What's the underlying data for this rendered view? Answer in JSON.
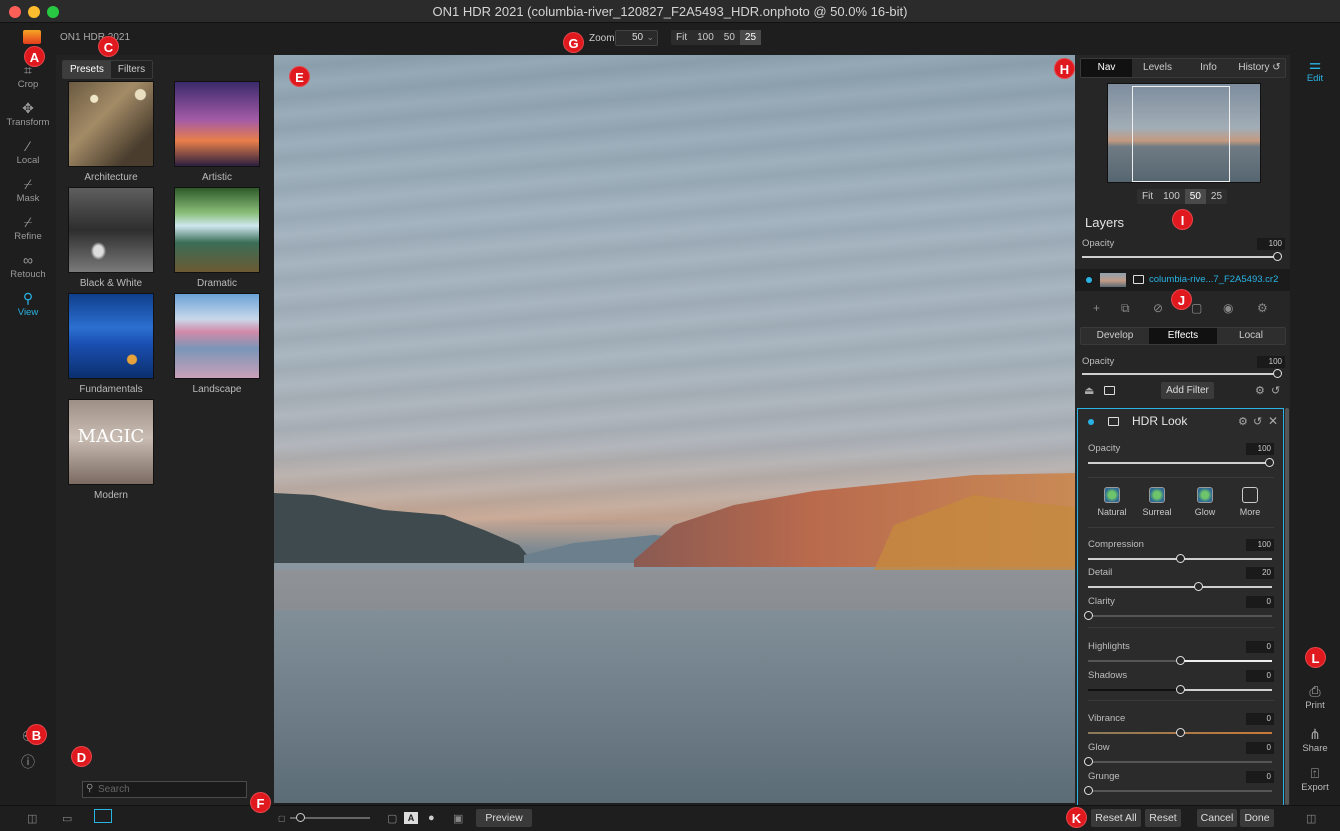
{
  "window": {
    "title": "ON1 HDR 2021 (columbia-river_120827_F2A5493_HDR.onphoto @ 50.0% 16-bit)"
  },
  "topbar": {
    "app_name": "ON1 HDR 2021",
    "zoom_label": "Zoom",
    "zoom_value": "50",
    "zoom_presets": [
      "Fit",
      "100",
      "50",
      "25"
    ],
    "zoom_selected": "25"
  },
  "markers": [
    "A",
    "B",
    "C",
    "D",
    "E",
    "F",
    "G",
    "H",
    "I",
    "J",
    "K",
    "L"
  ],
  "left_tools": [
    {
      "label": "Crop",
      "icon": "crop-icon"
    },
    {
      "label": "Transform",
      "icon": "move-icon"
    },
    {
      "label": "Local",
      "icon": "brush-icon"
    },
    {
      "label": "Mask",
      "icon": "mask-brush-icon"
    },
    {
      "label": "Refine",
      "icon": "refine-brush-icon"
    },
    {
      "label": "Retouch",
      "icon": "retouch-icon"
    },
    {
      "label": "View",
      "icon": "zoom-hand-icon",
      "active": true
    }
  ],
  "presets_panel": {
    "tabs": [
      "Presets",
      "Filters"
    ],
    "active_tab": "Presets",
    "categories": [
      "Architecture",
      "Artistic",
      "Black & White",
      "Dramatic",
      "Fundamentals",
      "Landscape",
      "Modern"
    ],
    "modern_thumb_text": "MAGIC",
    "search_placeholder": "Search"
  },
  "nav_panel": {
    "tabs": [
      "Nav",
      "Levels",
      "Info",
      "History"
    ],
    "active_tab": "Nav",
    "zoom_presets": [
      "Fit",
      "100",
      "50",
      "25"
    ],
    "zoom_selected": "50"
  },
  "layers": {
    "title": "Layers",
    "opacity_label": "Opacity",
    "opacity_value": "100",
    "opacity_fraction": 1.0,
    "layer_name": "columbia-rive...7_F2A5493.cr2"
  },
  "develop": {
    "tabs": [
      "Develop",
      "Effects",
      "Local"
    ],
    "active_tab": "Effects",
    "opacity_label": "Opacity",
    "opacity_value": "100",
    "add_filter_label": "Add Filter"
  },
  "hdr_look": {
    "title": "HDR Look",
    "opacity_label": "Opacity",
    "opacity_value": "100",
    "presets": [
      "Natural",
      "Surreal",
      "Glow",
      "More"
    ],
    "sliders": [
      {
        "label": "Compression",
        "value": "100",
        "fraction": 0.5
      },
      {
        "label": "Detail",
        "value": "20",
        "fraction": 0.6
      },
      {
        "label": "Clarity",
        "value": "0",
        "fraction": 0.0
      },
      {
        "label": "Highlights",
        "value": "0",
        "fraction": 0.5
      },
      {
        "label": "Shadows",
        "value": "0",
        "fraction": 0.5
      },
      {
        "label": "Vibrance",
        "value": "0",
        "fraction": 0.5
      },
      {
        "label": "Glow",
        "value": "0",
        "fraction": 0.0
      },
      {
        "label": "Grunge",
        "value": "0",
        "fraction": 0.0
      }
    ]
  },
  "right_tools": [
    {
      "label": "Edit",
      "icon": "sliders-icon",
      "active": true
    },
    {
      "label": "Print",
      "icon": "printer-icon"
    },
    {
      "label": "Share",
      "icon": "share-icon"
    },
    {
      "label": "Export",
      "icon": "export-icon"
    }
  ],
  "bottom": {
    "preview_label": "Preview",
    "compare_label": "A",
    "reset_all_label": "Reset All",
    "reset_label": "Reset",
    "cancel_label": "Cancel",
    "done_label": "Done"
  },
  "colors": {
    "accent": "#29b3e5",
    "marker": "#e0191f",
    "panel": "#262626"
  }
}
